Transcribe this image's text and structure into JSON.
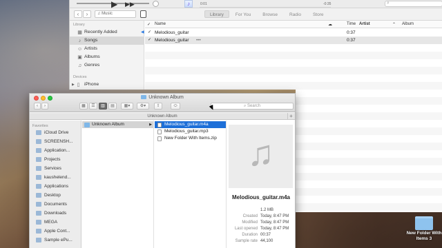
{
  "itunes": {
    "time_elapsed": "0:01",
    "time_remaining": "-0:35",
    "source_label": "Music",
    "tabs": [
      {
        "label": "Library",
        "active": true
      },
      {
        "label": "For You",
        "active": false
      },
      {
        "label": "Browse",
        "active": false
      },
      {
        "label": "Radio",
        "active": false
      },
      {
        "label": "Store",
        "active": false
      }
    ],
    "sidebar": {
      "library_title": "Library",
      "items": [
        {
          "label": "Recently Added",
          "icon": "recently-added-icon"
        },
        {
          "label": "Songs",
          "icon": "songs-icon",
          "selected": true
        },
        {
          "label": "Artists",
          "icon": "artists-icon"
        },
        {
          "label": "Albums",
          "icon": "albums-icon"
        },
        {
          "label": "Genres",
          "icon": "genres-icon"
        }
      ],
      "devices_title": "Devices",
      "device": "iPhone"
    },
    "columns": {
      "name": "Name",
      "time": "Time",
      "artist": "Artist",
      "album": "Album"
    },
    "songs": [
      {
        "name": "Melodious_guitar",
        "time": "0:37",
        "playing": true
      },
      {
        "name": "Melodious_guitar",
        "time": "0:37",
        "selected": true,
        "more": "•••"
      }
    ]
  },
  "finder": {
    "title": "Unknown Album",
    "path_title": "Unknown Album",
    "search_placeholder": "Search",
    "favorites_title": "Favorites",
    "favorites": [
      "iCloud Drive",
      "SCREENSH...",
      "Application...",
      "Projects",
      "Services",
      "kaushelend...",
      "Applications",
      "Desktop",
      "Documents",
      "Downloads",
      "MEGA",
      "Apple Cont...",
      "Sample ePu..."
    ],
    "column1": [
      {
        "name": "Unknown Album",
        "selected": true
      }
    ],
    "column2": [
      {
        "name": "Melodious_guitar.m4a",
        "selected": true
      },
      {
        "name": "Melodious_guitar.mp3"
      },
      {
        "name": "New Folder With Items.zip"
      }
    ],
    "preview": {
      "name": "Melodious_guitar.m4a",
      "size": "1.2 MB",
      "meta": [
        {
          "key": "Created",
          "value": "Today, 8:47 PM"
        },
        {
          "key": "Modified",
          "value": "Today, 8:47 PM"
        },
        {
          "key": "Last opened",
          "value": "Today, 8:47 PM"
        },
        {
          "key": "Duration",
          "value": "00:37"
        },
        {
          "key": "Sample rate",
          "value": "44,100"
        }
      ]
    }
  },
  "desktop": {
    "icon_label": "New Folder With Items 3"
  }
}
